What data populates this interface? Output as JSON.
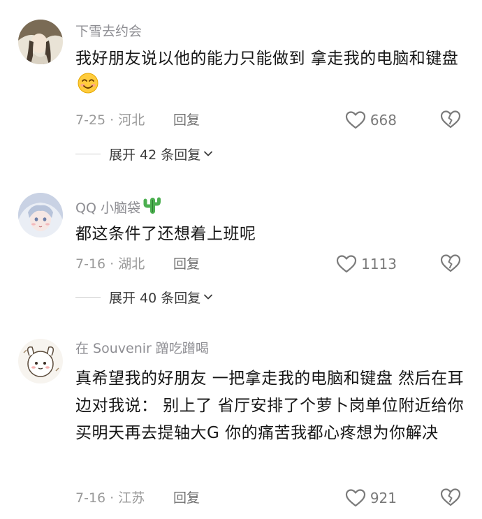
{
  "comments": [
    {
      "username": "下雪去约会",
      "text": "我好朋友说以他的能力只能做到 拿走我的电脑和键盘",
      "date_location": "7-25 · 河北",
      "reply_label": "回复",
      "likes": "668",
      "expand_label": "展开 42 条回复"
    },
    {
      "username": "QQ 小脑袋",
      "text": "都这条件了还想着上班呢",
      "date_location": "7-16 · 湖北",
      "reply_label": "回复",
      "likes": "1113",
      "expand_label": "展开 40 条回复"
    },
    {
      "username": "在 Souvenir 蹭吃蹭喝",
      "text": "真希望我的好朋友 一把拿走我的电脑和键盘 然后在耳边对我说： 别上了 省厅安排了个萝卜岗单位附近给你买明天再去提轴大G 你的痛苦我都心疼想为你解决",
      "date_location": "7-16 · 江苏",
      "reply_label": "回复",
      "likes": "921"
    }
  ],
  "icons": {
    "like": "heart-outline-icon",
    "dislike": "broken-heart-icon",
    "expand": "chevron-down-icon",
    "smiley": "smiling-face-emoji",
    "cactus": "cactus-emoji"
  }
}
